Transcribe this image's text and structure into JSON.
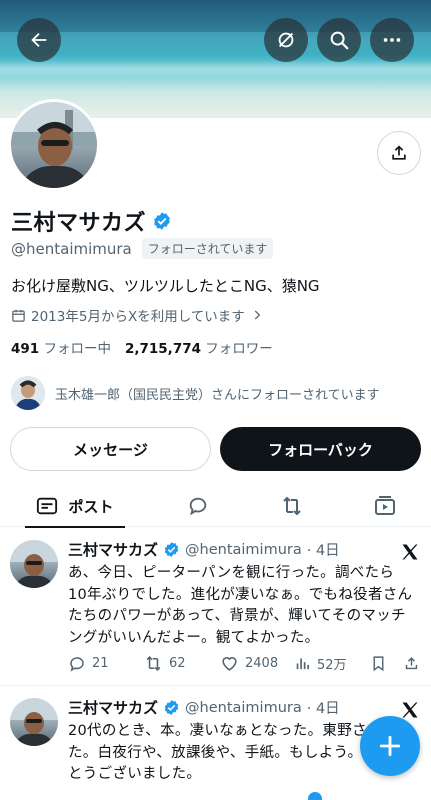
{
  "profile": {
    "display_name": "三村マサカズ",
    "handle": "@hentaimimura",
    "follows_you": "フォローされています",
    "bio": "お化け屋敷NG、ツルツルしたとこNG、猿NG",
    "joined": "2013年5月からXを利用しています",
    "following_count": "491",
    "following_label": "フォロー中",
    "followers_count": "2,715,774",
    "followers_label": "フォロワー",
    "followed_by": "玉木雄一郎（国民民主党）さんにフォローされています"
  },
  "buttons": {
    "message": "メッセージ",
    "follow_back": "フォローバック"
  },
  "tabs": [
    {
      "label": "ポスト",
      "active": true
    }
  ],
  "tweets": [
    {
      "name": "三村マサカズ",
      "handle": "@hentaimimura",
      "time": "· 4日",
      "text": "あ、今日、ピーターパンを観に行った。調べたら10年ぶりでした。進化が凄いなぁ。でもね役者さんたちのパワーがあって、背景が、輝いてそのマッチングがいいんだよー。観てよかった。",
      "replies": "21",
      "reposts": "62",
      "likes": "2408",
      "views": "52万"
    },
    {
      "name": "三村マサカズ",
      "handle": "@hentaimimura",
      "time": "· 4日",
      "text": "20代のとき、本。凄いなぁとなった。東野さんだった。白夜行や、放課後や、手紙。もしよう。ありがとうございました。"
    }
  ],
  "icons": {
    "back": "arrow-left-icon",
    "hide": "eye-slash-icon",
    "search": "search-icon",
    "more": "more-icon",
    "share": "share-icon",
    "verified": "verified-badge-icon",
    "calendar": "calendar-icon",
    "compose": "plus-icon"
  },
  "colors": {
    "accent": "#1d9bf0",
    "text": "#0f1419",
    "muted": "#536471"
  }
}
